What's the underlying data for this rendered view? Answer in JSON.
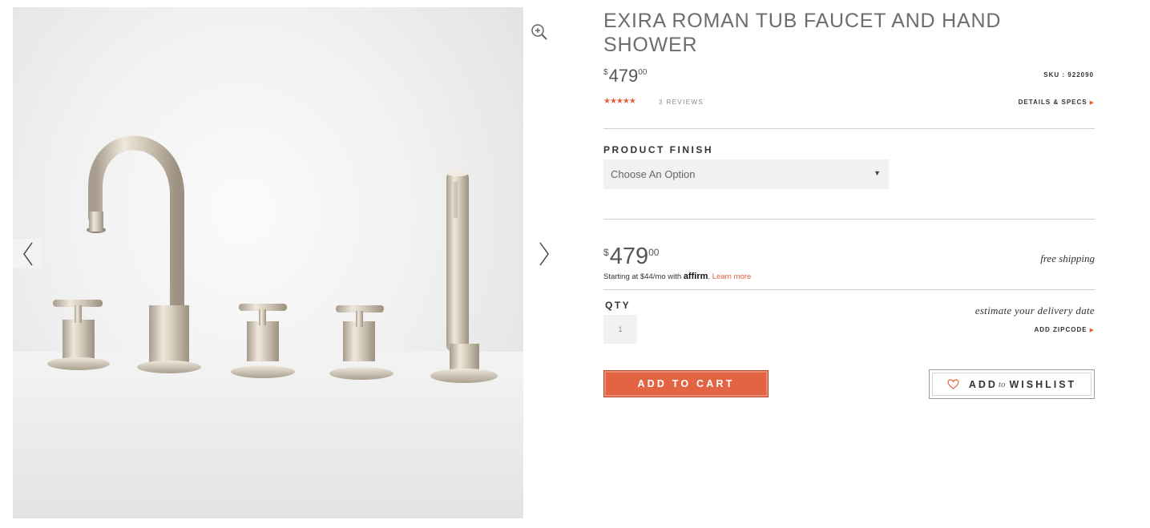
{
  "product": {
    "title": "EXIRA ROMAN TUB FAUCET AND HAND SHOWER",
    "price": {
      "currency": "$",
      "dollars": "479",
      "cents": "00"
    },
    "sku_label": "SKU : 922090",
    "rating": {
      "stars": "★★★★★",
      "value": 5,
      "reviews_label": "3 REVIEWS"
    },
    "details_label": "DETAILS & SPECS"
  },
  "finish": {
    "label": "PRODUCT FINISH",
    "selected": "Choose An Option"
  },
  "purchase": {
    "price": {
      "currency": "$",
      "dollars": "479",
      "cents": "00"
    },
    "financing_prefix": "Starting at $44/mo with ",
    "financing_brand": "affirm",
    "financing_suffix": ". ",
    "learn_more": "Learn more",
    "shipping": "free shipping",
    "qty_label": "QTY",
    "qty_value": "1",
    "estimate_label": "estimate your delivery date",
    "zip_label": "ADD ZIPCODE",
    "add_to_cart": "ADD TO CART",
    "wishlist_add": "ADD",
    "wishlist_to": "to",
    "wishlist_word": "WISHLIST"
  },
  "colors": {
    "accent": "#e36443",
    "stars": "#e0623c",
    "text": "#333333",
    "title": "#6d6d6d"
  },
  "icons": {
    "zoom": "zoom-in-icon",
    "prev": "chevron-left-icon",
    "next": "chevron-right-icon",
    "heart": "heart-icon",
    "arrow": "triangle-right-icon",
    "caret": "triangle-down-icon"
  }
}
